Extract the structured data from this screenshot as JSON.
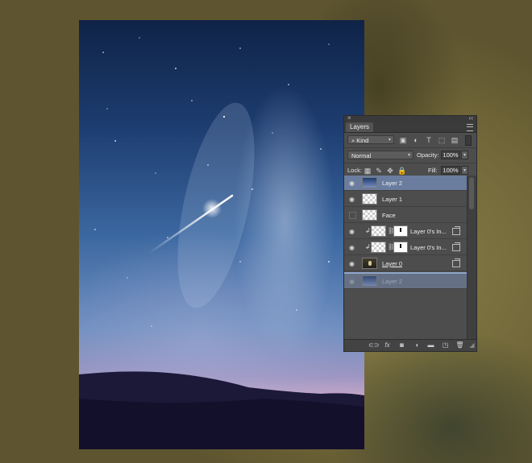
{
  "panel": {
    "tab_label": "Layers",
    "filter": {
      "kind_label": "Kind",
      "icons": [
        "image-filter-icon",
        "adjustment-filter-icon",
        "type-filter-icon",
        "shape-filter-icon",
        "smart-object-filter-icon"
      ]
    },
    "blend_mode": "Normal",
    "opacity_label": "Opacity:",
    "opacity_value": "100%",
    "lock_label": "Lock:",
    "fill_label": "Fill:",
    "fill_value": "100%",
    "layers": [
      {
        "name": "Layer 2",
        "visible": true,
        "selected": true,
        "thumb": "star"
      },
      {
        "name": "Layer 1",
        "visible": true,
        "thumb": "transparent"
      },
      {
        "name": "Face",
        "visible": false,
        "thumb": "transparent"
      },
      {
        "name": "Layer 0's In...",
        "visible": true,
        "clipped": true,
        "mask": true
      },
      {
        "name": "Layer 0's In...",
        "visible": true,
        "clipped": true,
        "mask": true
      },
      {
        "name": "Layer 0",
        "visible": true,
        "thumb": "face",
        "underlined": true
      },
      {
        "name": "Layer 2",
        "visible": true,
        "ghost": true,
        "thumb": "star"
      }
    ],
    "footer_icons": [
      "link-layers-icon",
      "fx-icon",
      "add-mask-icon",
      "adjustment-layer-icon",
      "new-group-icon",
      "new-layer-icon",
      "trash-icon"
    ]
  }
}
